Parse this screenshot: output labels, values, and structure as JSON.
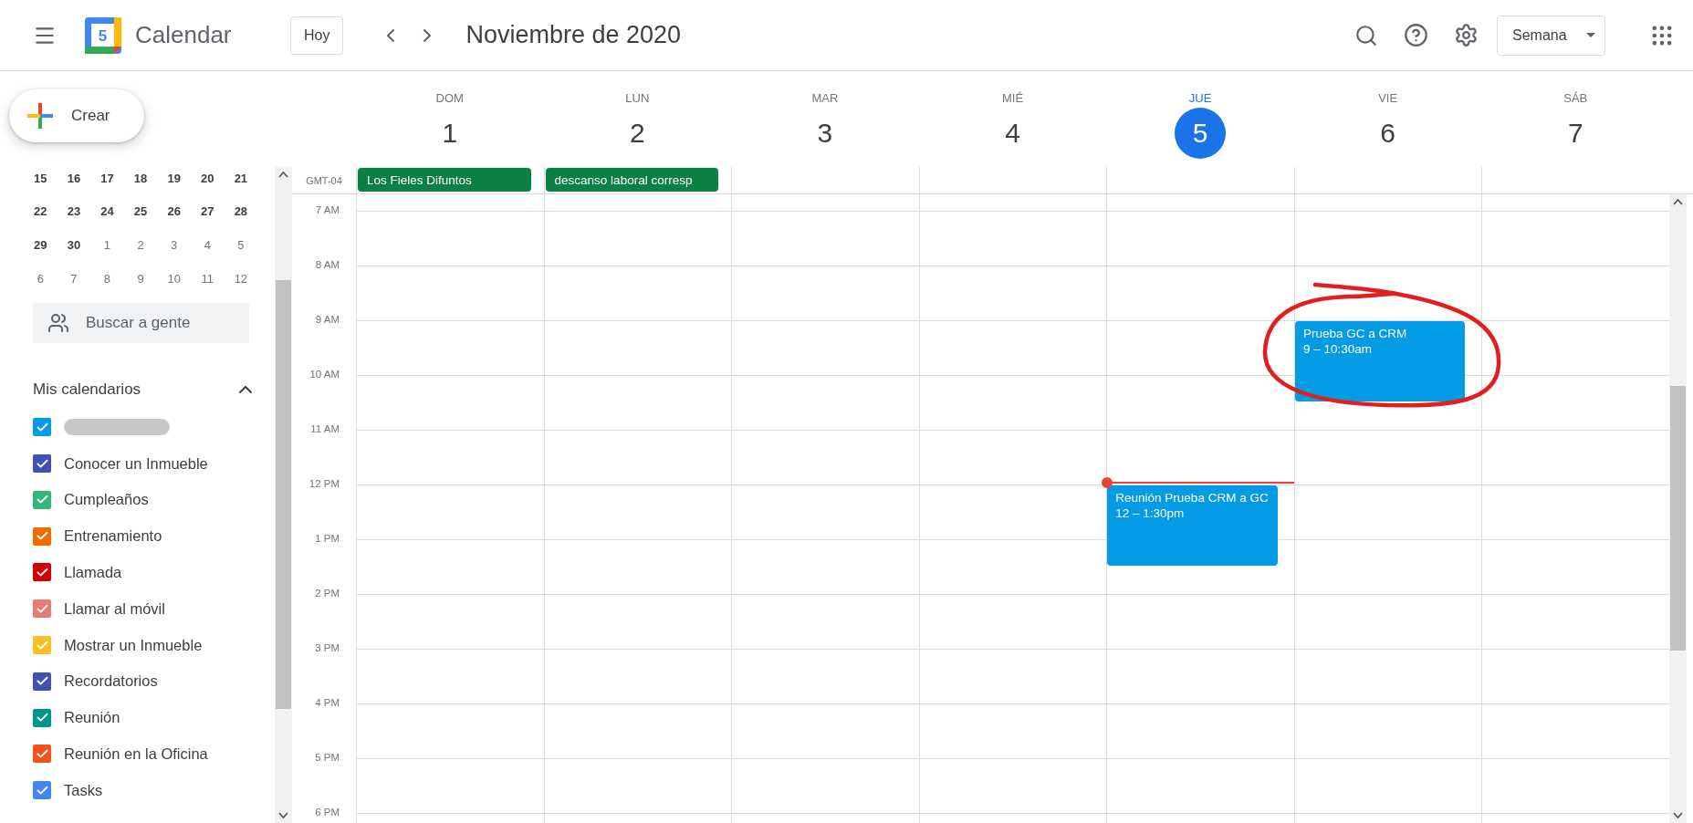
{
  "header": {
    "logo_day": "5",
    "app_name": "Calendar",
    "today_button": "Hoy",
    "period": "Noviembre de 2020",
    "view": "Semana"
  },
  "create_button": "Crear",
  "mini_calendar": {
    "weeks": [
      [
        {
          "day": "15",
          "muted": false
        },
        {
          "day": "16",
          "muted": false
        },
        {
          "day": "17",
          "muted": false
        },
        {
          "day": "18",
          "muted": false
        },
        {
          "day": "19",
          "muted": false
        },
        {
          "day": "20",
          "muted": false
        },
        {
          "day": "21",
          "muted": false
        }
      ],
      [
        {
          "day": "22",
          "muted": false
        },
        {
          "day": "23",
          "muted": false
        },
        {
          "day": "24",
          "muted": false
        },
        {
          "day": "25",
          "muted": false
        },
        {
          "day": "26",
          "muted": false
        },
        {
          "day": "27",
          "muted": false
        },
        {
          "day": "28",
          "muted": false
        }
      ],
      [
        {
          "day": "29",
          "muted": false
        },
        {
          "day": "30",
          "muted": false
        },
        {
          "day": "1",
          "muted": true
        },
        {
          "day": "2",
          "muted": true
        },
        {
          "day": "3",
          "muted": true
        },
        {
          "day": "4",
          "muted": true
        },
        {
          "day": "5",
          "muted": true
        }
      ],
      [
        {
          "day": "6",
          "muted": true
        },
        {
          "day": "7",
          "muted": true
        },
        {
          "day": "8",
          "muted": true
        },
        {
          "day": "9",
          "muted": true
        },
        {
          "day": "10",
          "muted": true
        },
        {
          "day": "11",
          "muted": true
        },
        {
          "day": "12",
          "muted": true
        }
      ]
    ]
  },
  "people_search": {
    "placeholder": "Buscar a gente"
  },
  "my_calendars": {
    "title": "Mis calendarios",
    "expanded": true,
    "items": [
      {
        "redacted": true,
        "checked": true,
        "color": "#039be5"
      },
      {
        "label": "Conocer un Inmueble",
        "redacted": false,
        "checked": true,
        "color": "#3f51b5"
      },
      {
        "label": "Cumpleaños",
        "redacted": false,
        "checked": true,
        "color": "#33b679"
      },
      {
        "label": "Entrenamiento",
        "redacted": false,
        "checked": true,
        "color": "#ef6c00"
      },
      {
        "label": "Llamada",
        "redacted": false,
        "checked": true,
        "color": "#d50000"
      },
      {
        "label": "Llamar al móvil",
        "redacted": false,
        "checked": true,
        "color": "#e67c73"
      },
      {
        "label": "Mostrar un Inmueble",
        "redacted": false,
        "checked": true,
        "color": "#f6bf26"
      },
      {
        "label": "Recordatorios",
        "redacted": false,
        "checked": true,
        "color": "#3f51b5"
      },
      {
        "label": "Reunión",
        "redacted": false,
        "checked": true,
        "color": "#009688"
      },
      {
        "label": "Reunión en la Oficina",
        "redacted": false,
        "checked": true,
        "color": "#f4511e"
      },
      {
        "label": "Tasks",
        "redacted": false,
        "checked": true,
        "color": "#4285f4"
      }
    ]
  },
  "week": {
    "timezone": "GMT-04",
    "current_time": {
      "level": 0.4986
    },
    "hours": [
      "7 AM",
      "8 AM",
      "9 AM",
      "10 AM",
      "11 AM",
      "12 PM",
      "1 PM",
      "2 PM",
      "3 PM",
      "4 PM",
      "5 PM",
      "6 PM"
    ],
    "days": [
      {
        "name": "DOM",
        "date": "1",
        "today": false,
        "all_day": [
          "Los Fieles Difuntos"
        ]
      },
      {
        "name": "LUN",
        "date": "2",
        "today": false,
        "all_day": [
          "descanso laboral corresp"
        ]
      },
      {
        "name": "MAR",
        "date": "3",
        "today": false
      },
      {
        "name": "MIÉ",
        "date": "4",
        "today": false
      },
      {
        "name": "JUE",
        "date": "5",
        "today": true,
        "events": [
          {
            "title": "Reunión Prueba CRM a GC",
            "time": "12 – 1:30pm"
          }
        ]
      },
      {
        "name": "VIE",
        "date": "6",
        "today": false,
        "events": [
          {
            "title": "Prueba GC a CRM",
            "time": "9 – 10:30am"
          }
        ]
      },
      {
        "name": "SÁB",
        "date": "7",
        "today": false
      }
    ]
  },
  "annotation": {
    "kind": "circle"
  }
}
